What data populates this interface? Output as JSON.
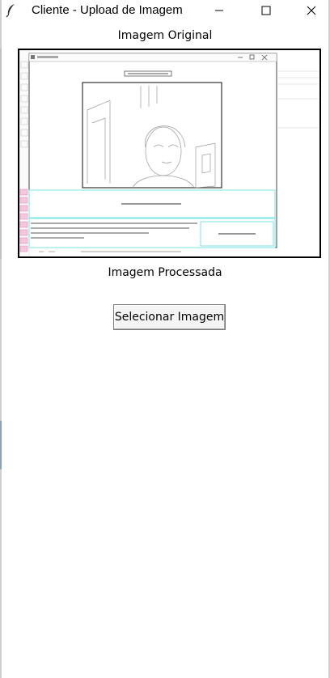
{
  "window": {
    "title": "Cliente - Upload de Imagem"
  },
  "labels": {
    "original": "Imagem Original",
    "processed": "Imagem Processada"
  },
  "buttons": {
    "select_image": "Selecionar Imagem"
  },
  "icons": {
    "app": "feather-icon",
    "minimize": "minimize-icon",
    "maximize": "maximize-icon",
    "close": "close-icon"
  }
}
